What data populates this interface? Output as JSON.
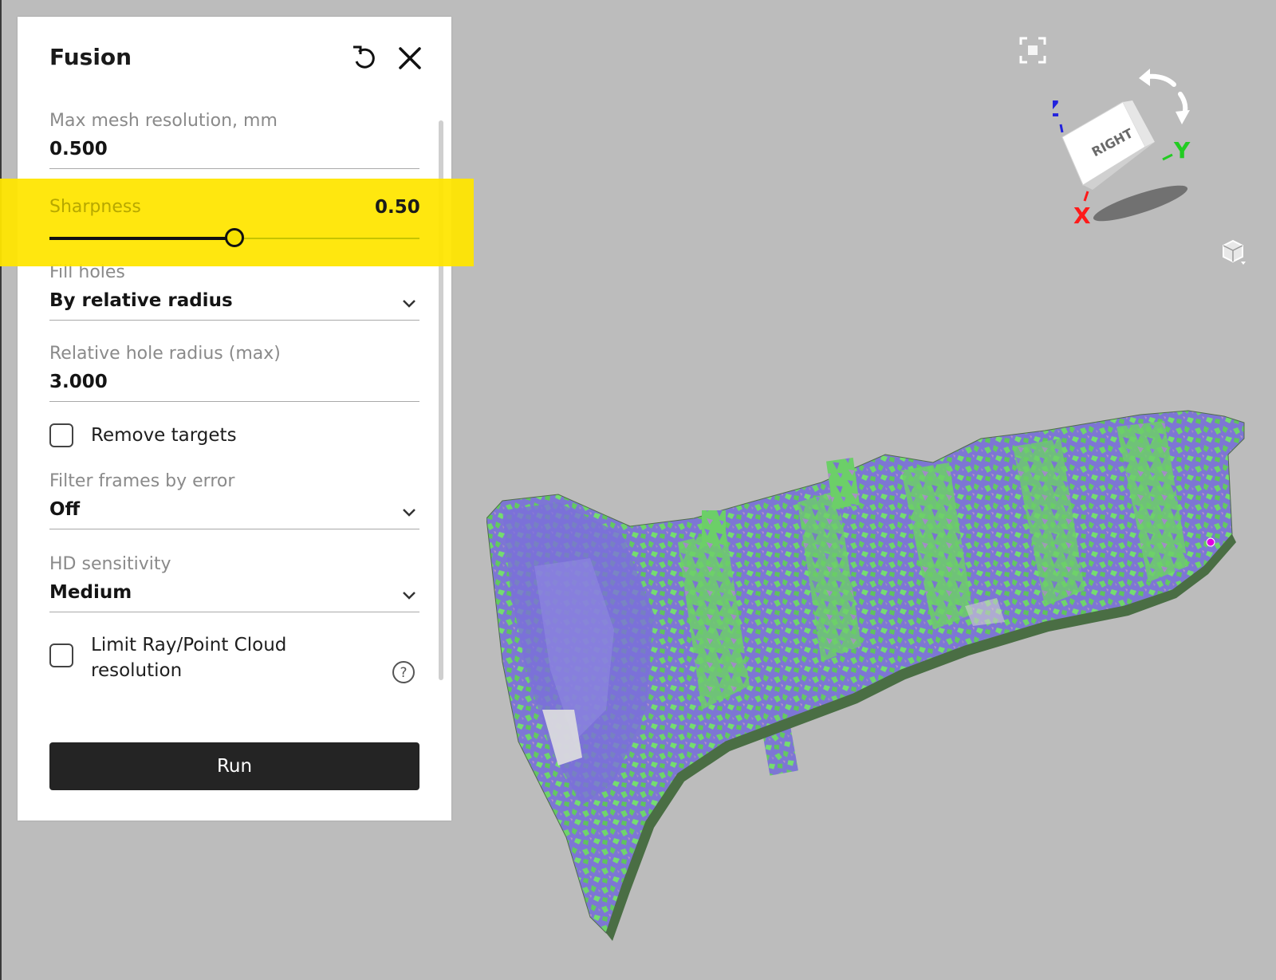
{
  "panel": {
    "title": "Fusion",
    "fields": {
      "max_mesh_resolution": {
        "label": "Max mesh resolution, mm",
        "value": "0.500"
      },
      "sharpness": {
        "label": "Sharpness",
        "value": "0.50",
        "level": 0.5
      },
      "fill_holes": {
        "label": "Fill holes",
        "value": "By relative radius"
      },
      "relative_hole_radius": {
        "label": "Relative hole radius (max)",
        "value": "3.000"
      },
      "remove_targets": {
        "label": "Remove targets",
        "checked": false
      },
      "filter_frames": {
        "label": "Filter frames by error",
        "value": "Off"
      },
      "hd_sensitivity": {
        "label": "HD sensitivity",
        "value": "Medium"
      },
      "limit_ray": {
        "label_line1": "Limit Ray/Point Cloud",
        "label_line2": "resolution",
        "checked": false
      }
    },
    "run_label": "Run",
    "icons": {
      "reset": "reset-icon",
      "close": "close-icon",
      "help": "help-icon",
      "chevron": "chevron-down-icon"
    }
  },
  "viewport": {
    "gizmo": {
      "face_label": "RIGHT",
      "axis_x": "X",
      "axis_y": "Y",
      "axis_z": "Z"
    },
    "icons": {
      "focus": "focus-icon",
      "view_cube": "view-cube-icon"
    },
    "colors": {
      "axis_x": "#ff1a1a",
      "axis_y": "#22cc22",
      "axis_z": "#2222dd",
      "mesh_blue": "#7a74d6",
      "mesh_green": "#6fd86a"
    }
  },
  "accent": {
    "highlight": "#ffe500"
  }
}
